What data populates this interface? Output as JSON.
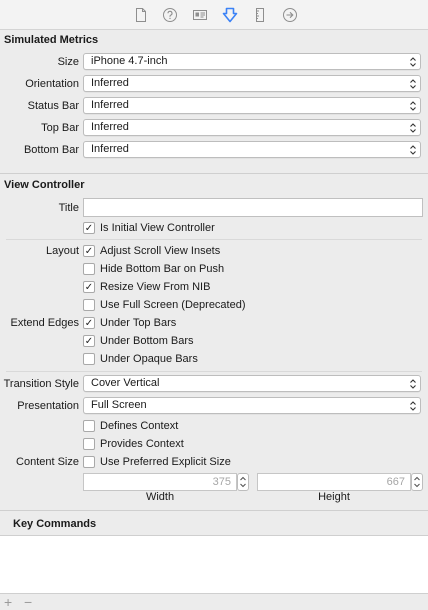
{
  "toolbar": {
    "tabs": [
      {
        "name": "file-inspector-icon",
        "active": false
      },
      {
        "name": "quick-help-icon",
        "active": false
      },
      {
        "name": "identity-inspector-icon",
        "active": false
      },
      {
        "name": "attributes-inspector-icon",
        "active": true
      },
      {
        "name": "size-inspector-icon",
        "active": false
      },
      {
        "name": "connections-inspector-icon",
        "active": false
      }
    ],
    "active_color": "#3b82f6"
  },
  "simulated_metrics": {
    "title": "Simulated Metrics",
    "size": {
      "label": "Size",
      "value": "iPhone 4.7-inch"
    },
    "orientation": {
      "label": "Orientation",
      "value": "Inferred"
    },
    "status_bar": {
      "label": "Status Bar",
      "value": "Inferred"
    },
    "top_bar": {
      "label": "Top Bar",
      "value": "Inferred"
    },
    "bottom_bar": {
      "label": "Bottom Bar",
      "value": "Inferred"
    }
  },
  "view_controller": {
    "title": "View Controller",
    "title_field": {
      "label": "Title",
      "value": ""
    },
    "is_initial": {
      "label": "Is Initial View Controller",
      "checked": true
    },
    "layout_label": "Layout",
    "adjust_scroll": {
      "label": "Adjust Scroll View Insets",
      "checked": true
    },
    "hide_bottom_bar": {
      "label": "Hide Bottom Bar on Push",
      "checked": false
    },
    "resize_from_nib": {
      "label": "Resize View From NIB",
      "checked": true
    },
    "use_full_screen": {
      "label": "Use Full Screen (Deprecated)",
      "checked": false
    },
    "extend_edges_label": "Extend Edges",
    "under_top_bars": {
      "label": "Under Top Bars",
      "checked": true
    },
    "under_bottom_bars": {
      "label": "Under Bottom Bars",
      "checked": true
    },
    "under_opaque_bars": {
      "label": "Under Opaque Bars",
      "checked": false
    },
    "transition_style": {
      "label": "Transition Style",
      "value": "Cover Vertical"
    },
    "presentation": {
      "label": "Presentation",
      "value": "Full Screen"
    },
    "defines_context": {
      "label": "Defines Context",
      "checked": false
    },
    "provides_context": {
      "label": "Provides Context",
      "checked": false
    },
    "content_size_label": "Content Size",
    "use_preferred_size": {
      "label": "Use Preferred Explicit Size",
      "checked": false
    },
    "width": {
      "label": "Width",
      "value": "375"
    },
    "height": {
      "label": "Height",
      "value": "667"
    }
  },
  "key_commands": {
    "title": "Key Commands",
    "add": "+",
    "remove": "−"
  },
  "check_glyph": "✓"
}
